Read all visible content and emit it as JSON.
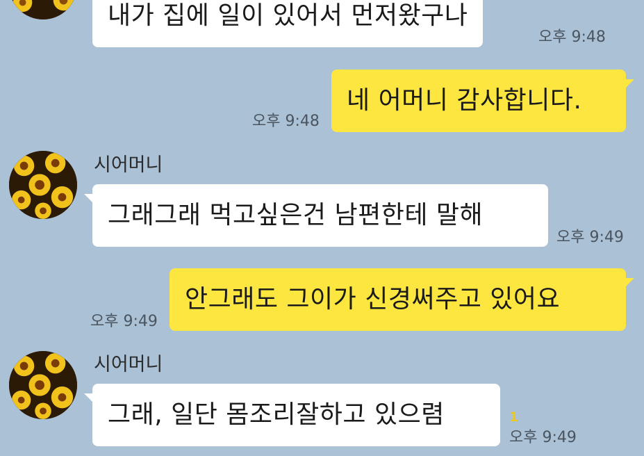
{
  "chat": {
    "messages": [
      {
        "direction": "incoming",
        "text": "내가 집에 일이 있어서 먼저왔구나",
        "time": "오후 9:48"
      },
      {
        "direction": "outgoing",
        "text": "네 어머니 감사합니다.",
        "time": "오후 9:48"
      },
      {
        "direction": "incoming",
        "sender": "시어머니",
        "text": "그래그래 먹고싶은건 남편한테 말해",
        "time": "오후 9:49"
      },
      {
        "direction": "outgoing",
        "text": "안그래도 그이가 신경써주고 있어요",
        "time": "오후 9:49"
      },
      {
        "direction": "incoming",
        "sender": "시어머니",
        "text": "그래, 일단 몸조리잘하고 있으렴",
        "time": "오후 9:49",
        "unread": "1"
      }
    ]
  },
  "colors": {
    "background": "#abc1d6",
    "incoming_bubble": "#ffffff",
    "outgoing_bubble": "#fde63f",
    "unread": "#e8c82a"
  },
  "icons": {
    "avatar": "sunflower-avatar-icon"
  }
}
